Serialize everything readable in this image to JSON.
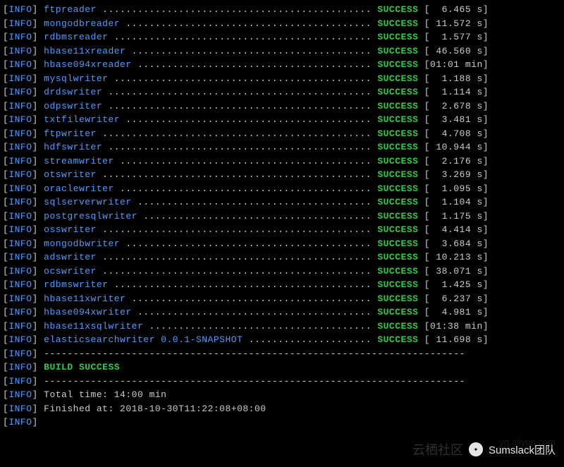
{
  "label": "INFO",
  "status": "SUCCESS",
  "rows": [
    {
      "module": "ftpreader",
      "time": "[  6.465 s]"
    },
    {
      "module": "mongodbreader",
      "time": "[ 11.572 s]"
    },
    {
      "module": "rdbmsreader",
      "time": "[  1.577 s]"
    },
    {
      "module": "hbase11xreader",
      "time": "[ 46.560 s]"
    },
    {
      "module": "hbase094xreader",
      "time": "[01:01 min]"
    },
    {
      "module": "mysqlwriter",
      "time": "[  1.188 s]"
    },
    {
      "module": "drdswriter",
      "time": "[  1.114 s]"
    },
    {
      "module": "odpswriter",
      "time": "[  2.678 s]"
    },
    {
      "module": "txtfilewriter",
      "time": "[  3.481 s]"
    },
    {
      "module": "ftpwriter",
      "time": "[  4.708 s]"
    },
    {
      "module": "hdfswriter",
      "time": "[ 10.944 s]"
    },
    {
      "module": "streamwriter",
      "time": "[  2.176 s]"
    },
    {
      "module": "otswriter",
      "time": "[  3.269 s]"
    },
    {
      "module": "oraclewriter",
      "time": "[  1.095 s]"
    },
    {
      "module": "sqlserverwriter",
      "time": "[  1.104 s]"
    },
    {
      "module": "postgresqlwriter",
      "time": "[  1.175 s]"
    },
    {
      "module": "osswriter",
      "time": "[  4.414 s]"
    },
    {
      "module": "mongodbwriter",
      "time": "[  3.684 s]"
    },
    {
      "module": "adswriter",
      "time": "[ 10.213 s]"
    },
    {
      "module": "ocswriter",
      "time": "[ 38.071 s]"
    },
    {
      "module": "rdbmswriter",
      "time": "[  1.425 s]"
    },
    {
      "module": "hbase11xwriter",
      "time": "[  6.237 s]"
    },
    {
      "module": "hbase094xwriter",
      "time": "[  4.981 s]"
    },
    {
      "module": "hbase11xsqlwriter",
      "time": "[01:38 min]"
    },
    {
      "module": "elasticsearchwriter 0.0.1-SNAPSHOT",
      "time": "[ 11.698 s]"
    }
  ],
  "separator": "------------------------------------------------------------------------",
  "buildSuccess": "BUILD SUCCESS",
  "summary": {
    "totalTime": "Total time: 14:00 min",
    "finishedAt": "Finished at: 2018-10-30T11:22:08+08:00"
  },
  "watermark": {
    "leftText": "云栖社区",
    "rightText": "Sumslack团队",
    "url": "yq.aliyun.com"
  },
  "layout": {
    "moduleColWidth": 56
  }
}
